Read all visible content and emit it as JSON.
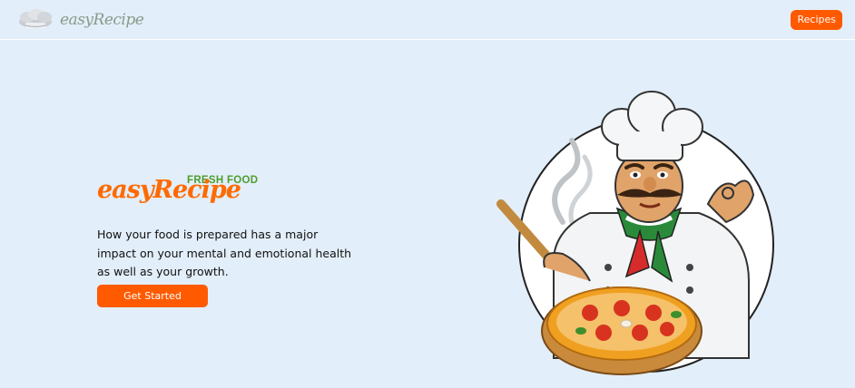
{
  "navbar": {
    "brand_name": "easyRecipe",
    "recipes_button": "Recipes"
  },
  "hero": {
    "tag": "FRESH FOOD",
    "title": "easyRecipe",
    "description": "How your food is prepared has a major impact on your mental and emotional health as well as your growth.",
    "cta_button": "Get Started"
  },
  "colors": {
    "background": "#e2eef9",
    "accent": "#ff5a00",
    "tag_green": "#4e9d2d"
  },
  "icons": {
    "brand_logo": "chef-hat-icon",
    "illustration": "chef-with-pizza-illustration"
  }
}
